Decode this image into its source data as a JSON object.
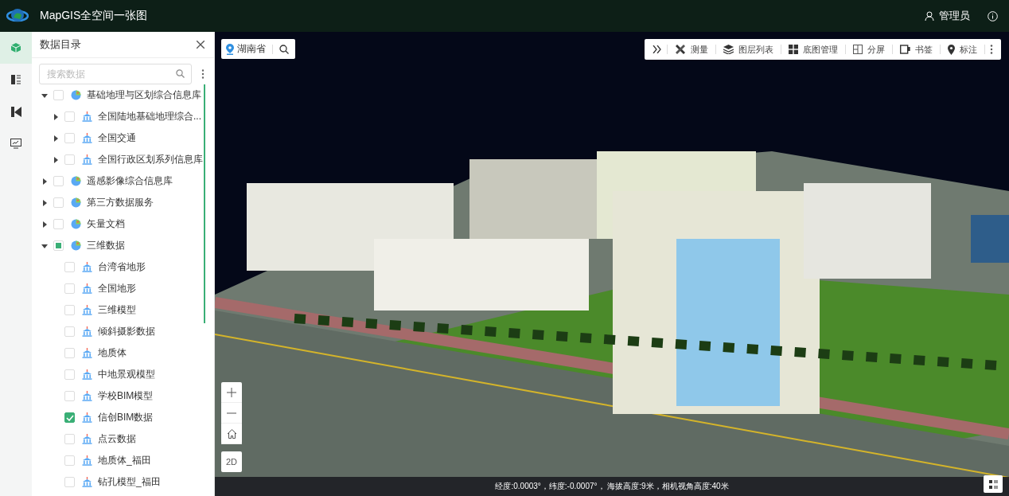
{
  "header": {
    "title": "MapGIS全空间一张图",
    "user": "管理员"
  },
  "rail": [
    {
      "selected": true
    },
    {
      "selected": false
    },
    {
      "selected": false
    },
    {
      "selected": false
    }
  ],
  "panel": {
    "title": "数据目录",
    "search": {
      "placeholder": "搜索数据"
    }
  },
  "tree": {
    "items": [
      {
        "label": "基础地理与区划综合信息库",
        "kind": "group",
        "checked": false,
        "partial": false,
        "expanded": true,
        "children": [
          {
            "label": "全国陆地基础地理综合...",
            "kind": "layer",
            "checked": false,
            "expanded": false
          },
          {
            "label": "全国交通",
            "kind": "layer",
            "checked": false,
            "expanded": false
          },
          {
            "label": "全国行政区划系列信息库",
            "kind": "layer",
            "checked": false,
            "expanded": false
          }
        ]
      },
      {
        "label": "遥感影像综合信息库",
        "kind": "group",
        "checked": false,
        "partial": false,
        "expanded": false
      },
      {
        "label": "第三方数据服务",
        "kind": "group",
        "checked": false,
        "partial": false,
        "expanded": false
      },
      {
        "label": "矢量文档",
        "kind": "group",
        "checked": false,
        "partial": false,
        "expanded": false
      },
      {
        "label": "三维数据",
        "kind": "group",
        "checked": false,
        "partial": true,
        "expanded": true,
        "children": [
          {
            "label": "台湾省地形",
            "kind": "layer",
            "checked": false
          },
          {
            "label": "全国地形",
            "kind": "layer",
            "checked": false
          },
          {
            "label": "三维模型",
            "kind": "layer",
            "checked": false
          },
          {
            "label": "倾斜摄影数据",
            "kind": "layer",
            "checked": false
          },
          {
            "label": "地质体",
            "kind": "layer",
            "checked": false
          },
          {
            "label": "中地景观模型",
            "kind": "layer",
            "checked": false
          },
          {
            "label": "学校BIM模型",
            "kind": "layer",
            "checked": false
          },
          {
            "label": "信创BIM数据",
            "kind": "layer",
            "checked": true
          },
          {
            "label": "点云数据",
            "kind": "layer",
            "checked": false
          },
          {
            "label": "地质体_福田",
            "kind": "layer",
            "checked": false
          },
          {
            "label": "钻孔模型_福田",
            "kind": "layer",
            "checked": false
          }
        ]
      }
    ]
  },
  "location": {
    "region": "湖南省"
  },
  "toolbar": [
    {
      "kind": "measure",
      "label": "测量"
    },
    {
      "kind": "layers",
      "label": "图层列表"
    },
    {
      "kind": "basemap",
      "label": "底图管理"
    },
    {
      "kind": "split",
      "label": "分屏"
    },
    {
      "kind": "bookmark",
      "label": "书签"
    },
    {
      "kind": "mark",
      "label": "标注"
    }
  ],
  "view_button": "2D",
  "status_bar": "经度:0.0003°，纬度:-0.0007°， 海拔高度:9米，相机视角高度:40米"
}
